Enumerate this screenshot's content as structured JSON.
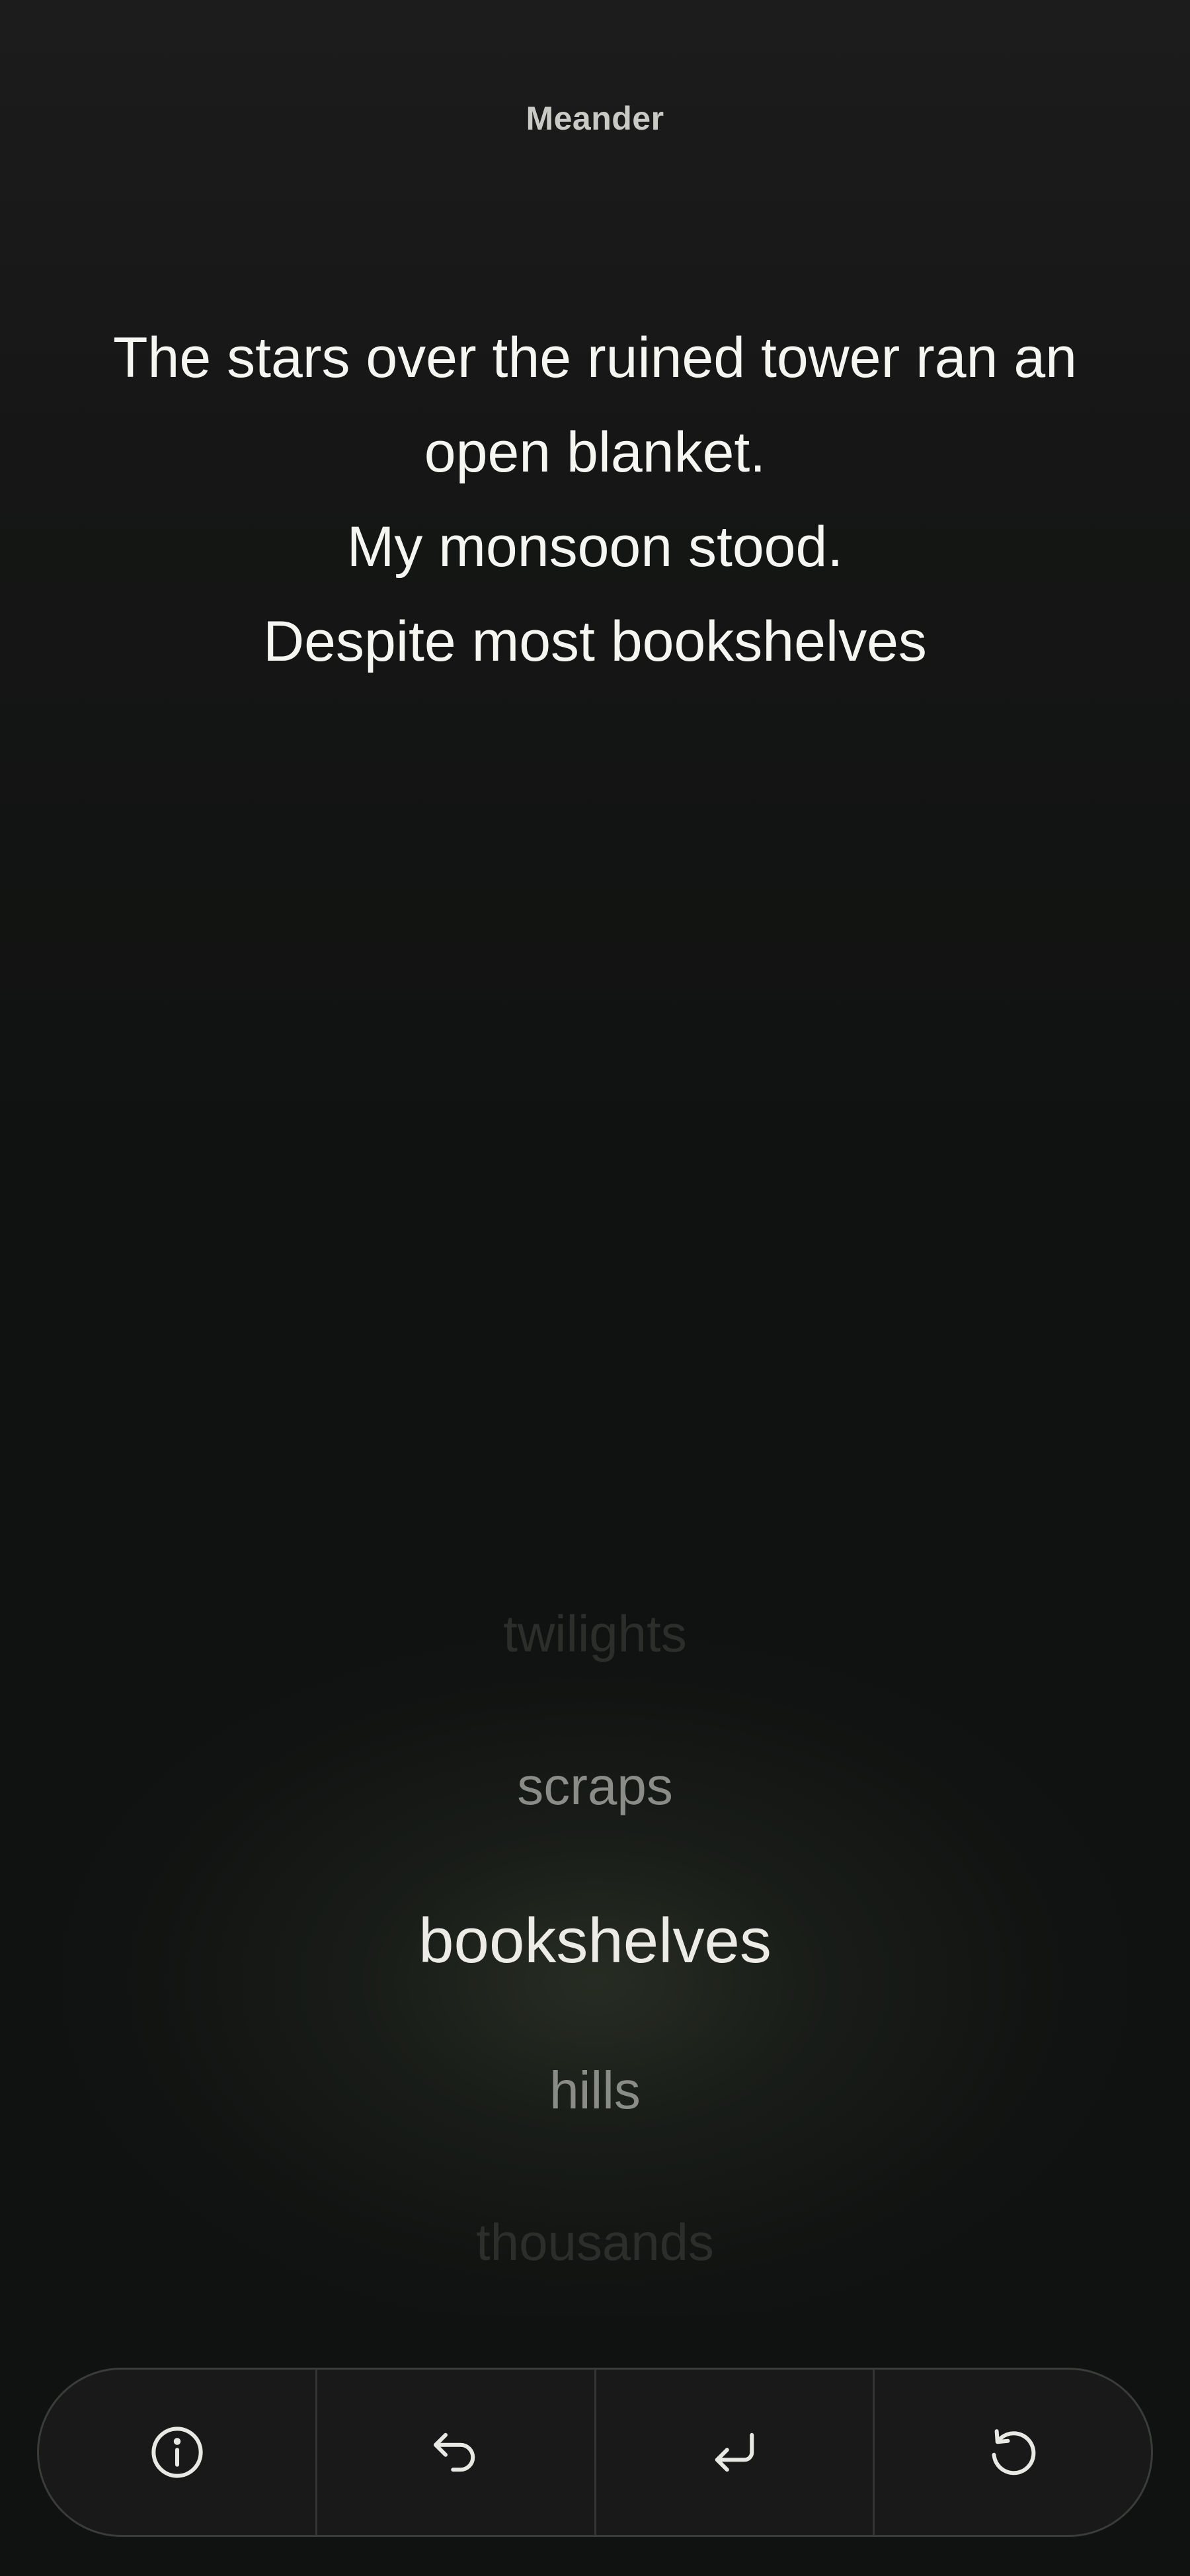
{
  "app": {
    "title": "Meander"
  },
  "poem": {
    "lines": [
      "The stars over the ruined tower ran an",
      "open blanket.",
      "My monsoon stood.",
      "Despite most bookshelves"
    ]
  },
  "picker": {
    "options": [
      "twilights",
      "scraps",
      "bookshelves",
      "hills",
      "thousands"
    ],
    "selected": "bookshelves"
  },
  "toolbar": {
    "buttons": [
      {
        "name": "info",
        "icon": "info-circle-icon"
      },
      {
        "name": "undo",
        "icon": "undo-arrow-icon"
      },
      {
        "name": "new-line",
        "icon": "return-arrow-icon"
      },
      {
        "name": "restart",
        "icon": "refresh-icon"
      }
    ]
  },
  "colors": {
    "background": "#111211",
    "text": "#f5f5f1",
    "muted": "#8a8c87",
    "faded": "#2c2e2b"
  }
}
